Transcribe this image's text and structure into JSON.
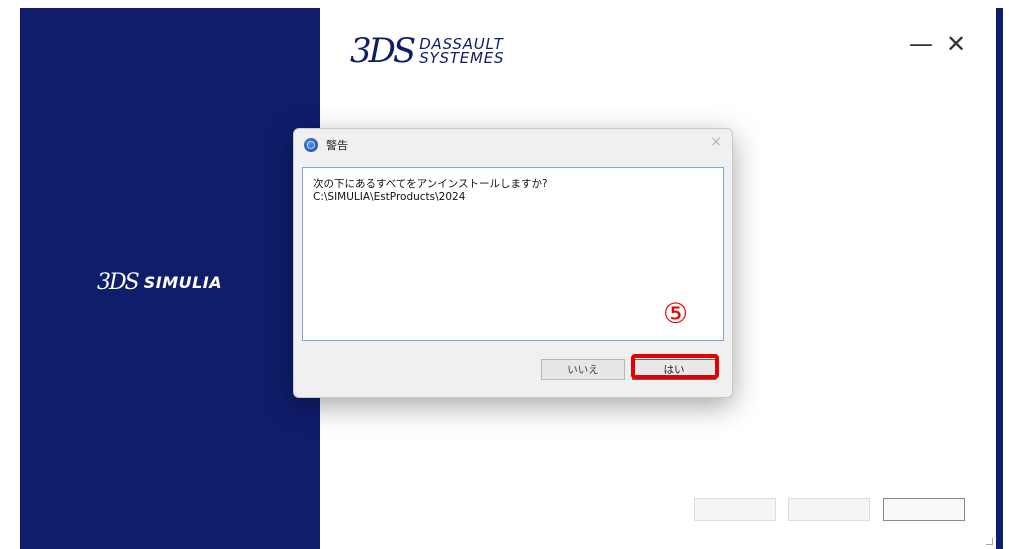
{
  "left_panel": {
    "logo_text": "SIMULIA",
    "logo_mark": "3DS"
  },
  "brand": {
    "mark": "3DS",
    "line1": "DASSAULT",
    "line2": "SYSTEMES"
  },
  "window_controls": {
    "minimize": "—",
    "close": "✕"
  },
  "dialog": {
    "title": "警告",
    "close_glyph": "×",
    "message_line1": "次の下にあるすべてをアンインストールしますか?",
    "message_line2": "C:\\SIMULIA\\EstProducts\\2024",
    "no_label": "いいえ",
    "yes_label": "はい"
  },
  "annotation": {
    "step": "⑤",
    "highlight_color": "#e60000"
  },
  "colors": {
    "panel": "#0f1d6b",
    "accent": "#e60000"
  }
}
